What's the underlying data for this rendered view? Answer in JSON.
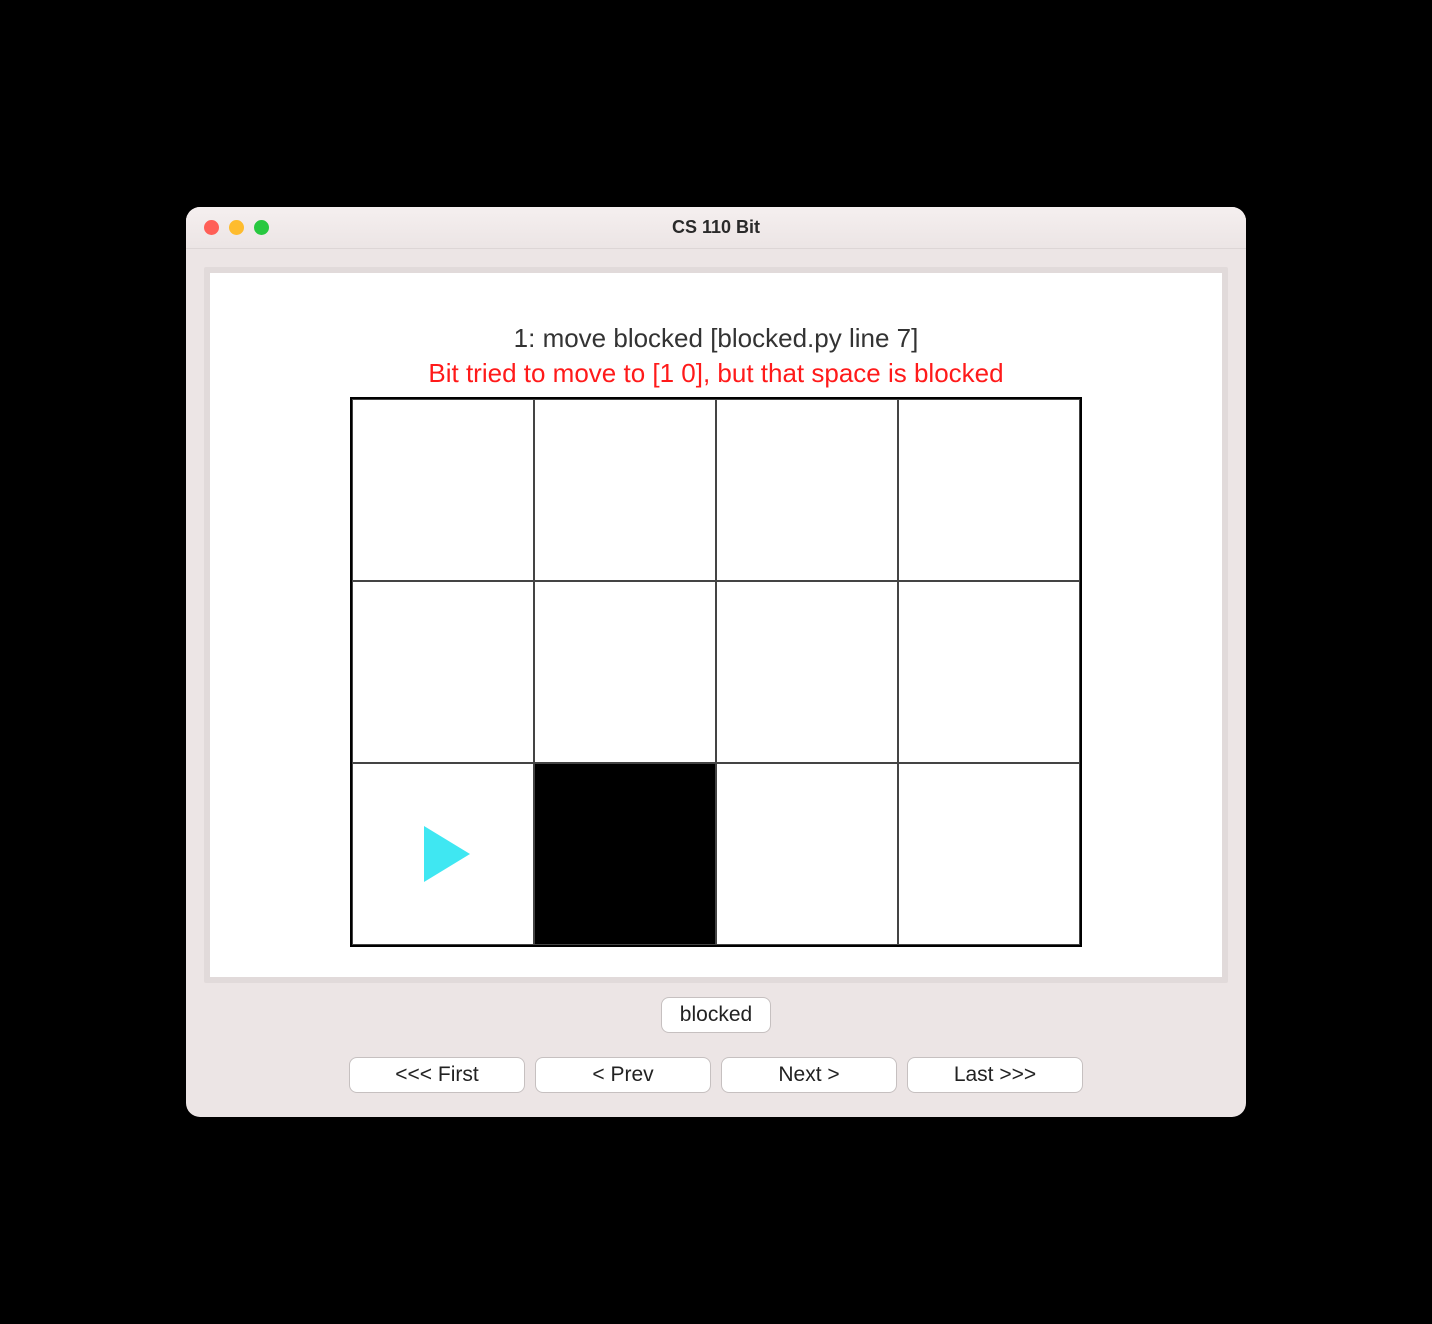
{
  "window": {
    "title": "CS 110 Bit"
  },
  "status": {
    "line": "1: move blocked  [blocked.py line 7]",
    "error": "Bit tried to move to [1 0], but that space is blocked"
  },
  "grid": {
    "cols": 4,
    "rows": 3,
    "bit": {
      "col": 0,
      "row": 2,
      "direction": "right",
      "color": "#3fe7f2"
    },
    "blocked_cells": [
      {
        "col": 1,
        "row": 2
      }
    ]
  },
  "buttons": {
    "scenario": "blocked",
    "first": "<<< First",
    "prev": "< Prev",
    "next": "Next >",
    "last": "Last >>>"
  }
}
